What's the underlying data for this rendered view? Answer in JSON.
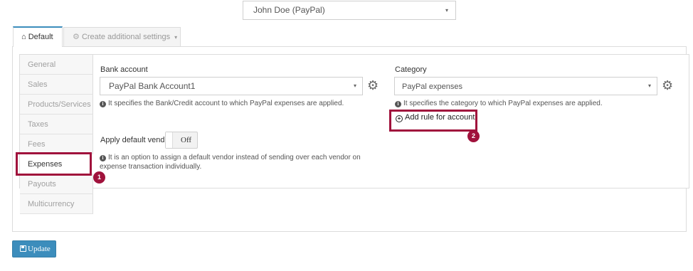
{
  "account_select": {
    "value": "John Doe (PayPal)",
    "caret": "▾"
  },
  "tabs": {
    "default": {
      "icon": "home-icon",
      "glyph": "⌂",
      "label": "Default"
    },
    "additional": {
      "icon": "gear-icon",
      "glyph": "⚙",
      "label": "Create additional settings",
      "caret": "▾"
    }
  },
  "side_nav": [
    {
      "label": "General",
      "active": false
    },
    {
      "label": "Sales",
      "active": false
    },
    {
      "label": "Products/Services",
      "active": false
    },
    {
      "label": "Taxes",
      "active": false
    },
    {
      "label": "Fees",
      "active": false
    },
    {
      "label": "Expenses",
      "active": true
    },
    {
      "label": "Payouts",
      "active": false
    },
    {
      "label": "Multicurrency",
      "active": false
    }
  ],
  "bank": {
    "label": "Bank account",
    "value": "PayPal Bank Account1",
    "caret": "▾",
    "help": "It specifies the Bank/Credit account to which PayPal expenses are applied."
  },
  "vendor": {
    "label": "Apply default vendor",
    "toggle_text": "Off",
    "help_line1": "It is an option to assign a default vendor instead of sending over each vendor on",
    "help_line2": "expense transaction individually."
  },
  "category": {
    "label": "Category",
    "value": "PayPal expenses",
    "caret": "▾",
    "help": "It specifies the category to which PayPal expenses are applied."
  },
  "add_rule": {
    "label": "Add rule for account",
    "icon": "plus-circle-icon"
  },
  "badges": {
    "one": "1",
    "two": "2"
  },
  "update_button": {
    "label": "Update",
    "icon": "save-icon"
  },
  "colors": {
    "accent": "#3c8dbc",
    "highlight": "#a0123c"
  }
}
